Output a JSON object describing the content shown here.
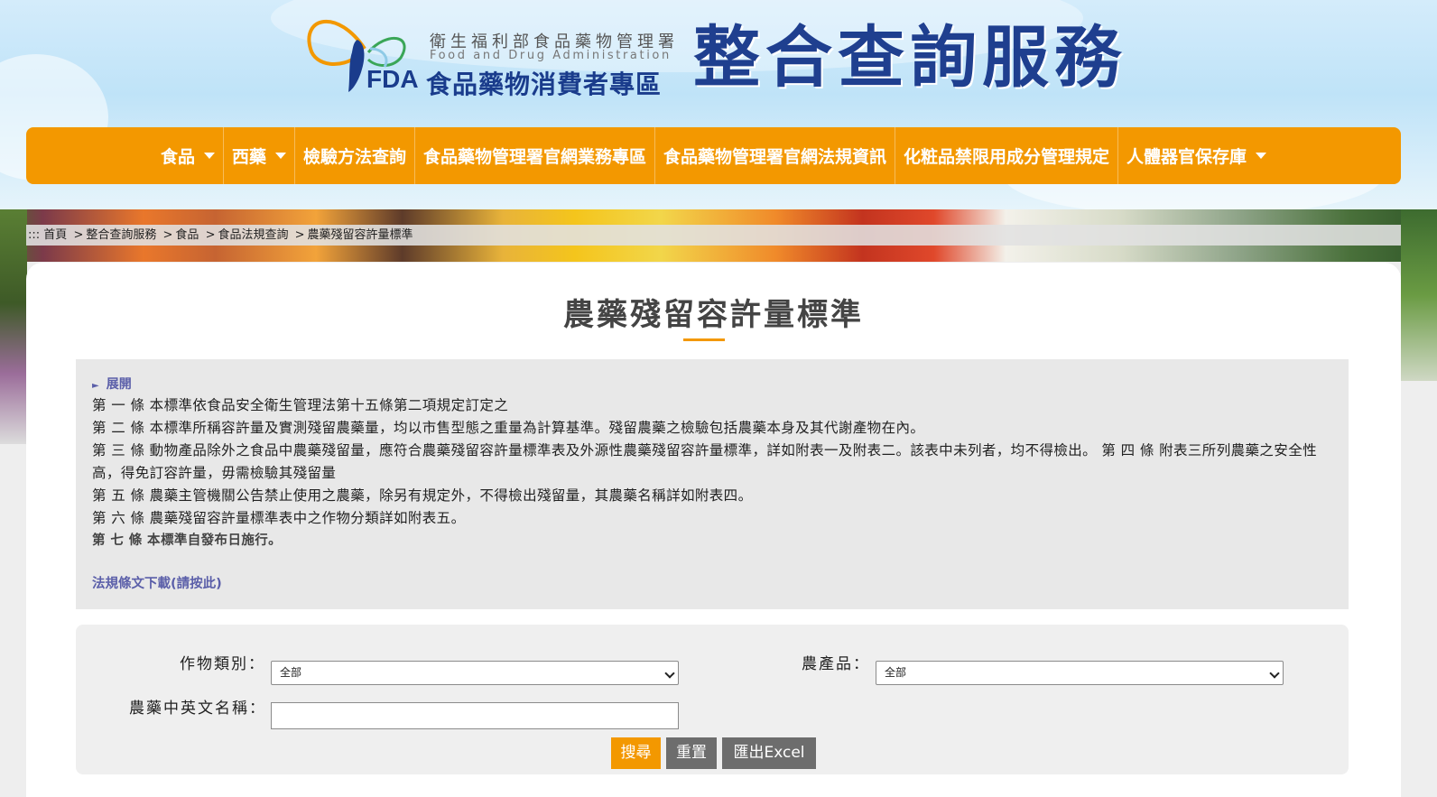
{
  "header": {
    "agency_name": "衛生福利部食品藥物管理署",
    "agency_name_en": "Food and Drug Administration",
    "logo_mark": "FDA",
    "zone_name": "食品藥物消費者專區",
    "site_title": "整合查詢服務"
  },
  "nav": {
    "items": [
      {
        "label": "食品",
        "dropdown": true
      },
      {
        "label": "西藥",
        "dropdown": true
      },
      {
        "label": "檢驗方法查詢",
        "dropdown": false
      },
      {
        "label": "食品藥物管理署官網業務專區",
        "dropdown": false
      },
      {
        "label": "食品藥物管理署官網法規資訊",
        "dropdown": false
      },
      {
        "label": "化粧品禁限用成分管理規定",
        "dropdown": false
      },
      {
        "label": "人體器官保存庫",
        "dropdown": true
      }
    ]
  },
  "breadcrumb": {
    "prefix": ":::",
    "items": [
      "首頁",
      "整合查詢服務",
      "食品",
      "食品法規查詢",
      "農藥殘留容許量標準"
    ],
    "separator": ">"
  },
  "page": {
    "title": "農藥殘留容許量標準"
  },
  "rules": {
    "expand_label": "展開",
    "lines": [
      "第 一 條 本標準依食品安全衛生管理法第十五條第二項規定訂定之",
      "第 二 條 本標準所稱容許量及實測殘留農藥量，均以市售型態之重量為計算基準。殘留農藥之檢驗包括農藥本身及其代謝產物在內。",
      "第 三 條 動物產品除外之食品中農藥殘留量，應符合農藥殘留容許量標準表及外源性農藥殘留容許量標準，詳如附表一及附表二。該表中未列者，均不得檢出。 第 四 條 附表三所列農藥之安全性高，得免訂容許量，毋需檢驗其殘留量",
      "第 五 條 農藥主管機關公告禁止使用之農藥，除另有規定外，不得檢出殘留量，其農藥名稱詳如附表四。",
      "第 六 條 農藥殘留容許量標準表中之作物分類詳如附表五。",
      "第 七 條 本標準自發布日施行。"
    ],
    "download_link": "法規條文下載(請按此)"
  },
  "search": {
    "crop_category_label": "作物類別：",
    "crop_category_value": "全部",
    "product_label": "農產品：",
    "product_value": "全部",
    "pesticide_name_label": "農藥中英文名稱：",
    "pesticide_name_value": "",
    "search_button": "搜尋",
    "reset_button": "重置",
    "export_button": "匯出Excel"
  },
  "colors": {
    "accent": "#f39800",
    "brand_blue": "#1f3f8f",
    "link": "#5b5fa9",
    "button_gray": "#6d6d6d"
  }
}
